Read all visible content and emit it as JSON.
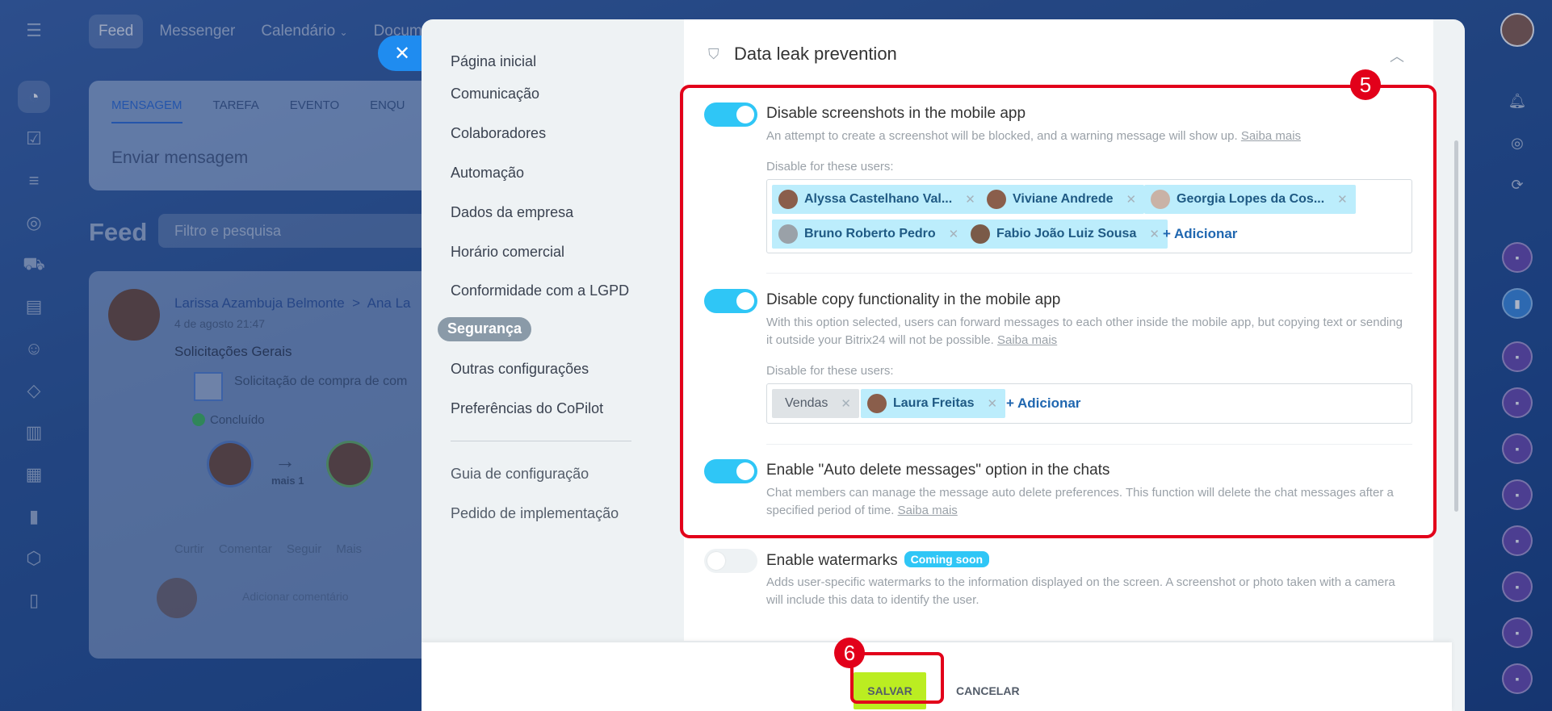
{
  "background": {
    "topnav": [
      "Feed",
      "Messenger",
      "Calendário",
      "Documen"
    ],
    "composer_tabs": [
      "MENSAGEM",
      "TAREFA",
      "EVENTO",
      "ENQU"
    ],
    "composer_placeholder": "Enviar mensagem",
    "feed_title": "Feed",
    "feed_filter_placeholder": "Filtro e pesquisa",
    "post": {
      "author": "Larissa Azambuja Belmonte",
      "recipient": "Ana La",
      "date": "4 de agosto 21:47",
      "title": "Solicitações Gerais",
      "request": "Solicitação de compra de com",
      "status": "Concluído",
      "more": "mais 1",
      "actions": "Curtir Comentar Seguir Mais",
      "reply_placeholder": "Adicionar comentário"
    }
  },
  "nav": {
    "items": [
      "Página inicial",
      "Comunicação",
      "Colaboradores",
      "Automação",
      "Dados da empresa",
      "Horário comercial",
      "Conformidade com a LGPD",
      "Segurança",
      "Outras configurações",
      "Preferências do CoPilot"
    ],
    "active": "Segurança",
    "secondary": [
      "Guia de configuração",
      "Pedido de implementação"
    ]
  },
  "section": {
    "title": "Data leak prevention"
  },
  "options": [
    {
      "title": "Disable screenshots in the mobile app",
      "desc": "An attempt to create a screenshot will be blocked, and a warning message will show up.",
      "more": "Saiba mais",
      "enabled": true,
      "users_label": "Disable for these users:",
      "users": [
        "Alyssa Castelhano Val...",
        "Viviane Andrede",
        "Georgia Lopes da Cos...",
        "Bruno Roberto Pedro",
        "Fabio João Luiz Sousa"
      ],
      "add_label": "+ Adicionar"
    },
    {
      "title": "Disable copy functionality in the mobile app",
      "desc": "With this option selected, users can forward messages to each other inside the mobile app, but copying text or sending it outside your Bitrix24 will not be possible.",
      "more": "Saiba mais",
      "enabled": true,
      "users_label": "Disable for these users:",
      "users": [
        "Vendas",
        "Laura Freitas"
      ],
      "add_label": "+ Adicionar"
    },
    {
      "title": "Enable \"Auto delete messages\" option in the chats",
      "desc": "Chat members can manage the message auto delete preferences. This function will delete the chat messages after a specified period of time.",
      "more": "Saiba mais",
      "enabled": true
    },
    {
      "title": "Enable watermarks",
      "badge": "Coming soon",
      "desc": "Adds user-specific watermarks to the information displayed on the screen. A screenshot or photo taken with a camera will include this data to identify the user.",
      "enabled": false
    }
  ],
  "footer": {
    "save": "SALVAR",
    "cancel": "CANCELAR"
  },
  "annotations": {
    "box_badge": "5",
    "save_badge": "6"
  },
  "colors": {
    "toggle_on": "#2fc6f6",
    "save_button": "#bbed21",
    "annotation": "#e2001a",
    "tag_bg": "#bcedfc"
  }
}
